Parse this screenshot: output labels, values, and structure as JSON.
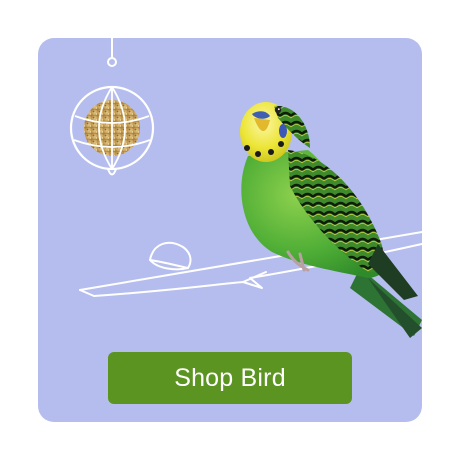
{
  "tile": {
    "cta_label": "Shop Bird",
    "icons": {
      "feeder": "seed-ball-feeder-icon",
      "branch": "branch-outline-icon",
      "bird": "budgie-parakeet-image"
    },
    "colors": {
      "tile_background": "#b5bdee",
      "cta_background": "#5c9422",
      "cta_text": "#ffffff",
      "line_art": "#ffffff",
      "bird_body": "#56b33a",
      "bird_head": "#e6e326"
    }
  }
}
